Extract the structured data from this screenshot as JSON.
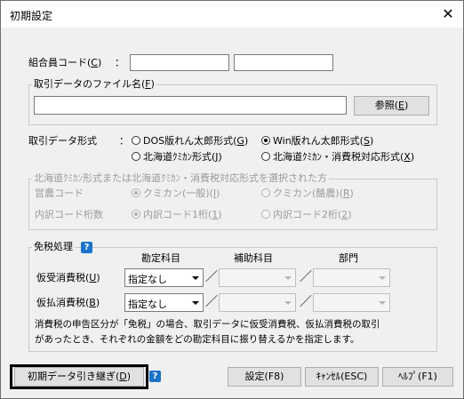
{
  "window": {
    "title": "初期設定",
    "close_glyph": "✕"
  },
  "member": {
    "label": "組合員コード(",
    "key": "C",
    "label_end": ")",
    "colon": "：",
    "value1": "",
    "value2": ""
  },
  "file": {
    "legend": "取引データのファイル名(",
    "key": "F",
    "legend_end": ")",
    "value": "",
    "browse_label": "参照(",
    "browse_key": "E",
    "browse_end": ")"
  },
  "format": {
    "label": "取引データ形式",
    "colon": "：",
    "options": [
      {
        "text": "DOS版れん太郎形式(",
        "key": "G",
        "end": ")",
        "checked": false
      },
      {
        "text": "Win版れん太郎形式(",
        "key": "S",
        "end": ")",
        "checked": true
      },
      {
        "text": "北海道ｸﾐｶﾝ形式(",
        "key": "J",
        "end": ")",
        "checked": false
      },
      {
        "text": "北海道ｸﾐｶﾝ・消費税対応形式(",
        "key": "X",
        "end": ")",
        "checked": false
      }
    ]
  },
  "hokkaido": {
    "legend": "北海道ｸﾐｶﾝ形式または北海道ｸﾐｶﾝ・消費税対応形式を選択された方",
    "farm_label": "営農コード",
    "farm_opts": [
      {
        "text": "クミカン(一般)(",
        "key": "I",
        "end": ")",
        "checked": true
      },
      {
        "text": "クミカン(酪農)(",
        "key": "R",
        "end": ")",
        "checked": false
      }
    ],
    "digit_label": "内訳コード桁数",
    "digit_opts": [
      {
        "text": "内訳コード1桁(",
        "key": "1",
        "end": ")",
        "checked": true
      },
      {
        "text": "内訳コード2桁(",
        "key": "2",
        "end": ")",
        "checked": false
      }
    ]
  },
  "tax": {
    "legend": "免税処理",
    "col_account": "勘定科目",
    "col_sub": "補助科目",
    "col_dept": "部門",
    "rows": [
      {
        "label": "仮受消費税(",
        "key": "U",
        "end": ")",
        "account": "指定なし"
      },
      {
        "label": "仮払消費税(",
        "key": "B",
        "end": ")",
        "account": "指定なし"
      }
    ],
    "slash": "／",
    "note1": "消費税の申告区分が「免税」の場合、取引データに仮受消費税、仮払消費税の取引",
    "note2": "があったとき、それぞれの金額をどの勘定科目に振り替えるかを指定します。"
  },
  "footer": {
    "carryover_label": "初期データ引き継ぎ(",
    "carryover_key": "D",
    "carryover_end": ")",
    "help_glyph": "?",
    "ok_label": "設定(F8)",
    "cancel_label": "ｷｬﾝｾﾙ(ESC)",
    "helpbtn_label": "ﾍﾙﾌﾟ(F1)"
  },
  "colors": {
    "accent": "#1a73c8",
    "highlight": "#000000"
  }
}
